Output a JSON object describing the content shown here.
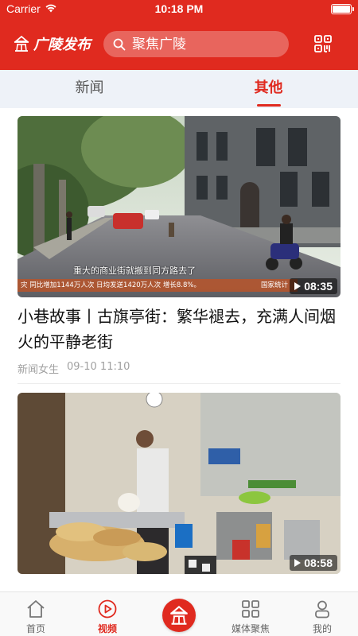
{
  "status_bar": {
    "carrier": "Carrier",
    "time": "10:18 PM"
  },
  "header": {
    "logo_text": "广陵发布",
    "search_placeholder": "聚焦广陵",
    "colors": {
      "brand": "#e02a1f"
    }
  },
  "tabs": [
    {
      "label": "新闻",
      "active": false
    },
    {
      "label": "其他",
      "active": true
    }
  ],
  "feed": [
    {
      "title": "小巷故事丨古旗亭街：繁华褪去，充满人间烟火的平静老街",
      "source": "新闻女生",
      "time": "09-10 11:10",
      "duration": "08:35",
      "video_caption": "重大的商业街就搬到同方路去了",
      "ticker": "灾  同比增加1144万人次  日均发送1420万人次  增长8.8%。",
      "ticker_brand": "国家统计"
    },
    {
      "title": "",
      "source": "",
      "time": "",
      "duration": "08:58"
    }
  ],
  "bottom_nav": [
    {
      "label": "首页",
      "icon": "home-icon",
      "active": false
    },
    {
      "label": "视频",
      "icon": "play-circle-icon",
      "active": true
    },
    {
      "label": "",
      "icon": "logo-icon",
      "active": false
    },
    {
      "label": "媒体聚焦",
      "icon": "grid-icon",
      "active": false
    },
    {
      "label": "我的",
      "icon": "person-icon",
      "active": false
    }
  ]
}
